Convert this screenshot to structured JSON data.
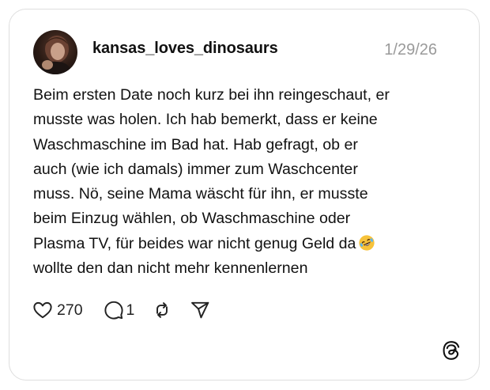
{
  "post": {
    "username": "kansas_loves_dinosaurs",
    "date": "1/29/26",
    "text_lines": [
      "Beim ersten Date noch kurz bei ihn reingeschaut, er",
      "musste was holen. Ich hab bemerkt, dass er keine",
      "Waschmaschine im Bad hat. Hab gefragt, ob er",
      "auch (wie ich damals) immer zum Waschcenter",
      "muss. Nö, seine Mama wäscht für ihn, er musste",
      "beim Einzug wählen, ob Waschmaschine oder",
      "Plasma TV, für beides war nicht genug Geld da",
      "wollte den dan nicht mehr kennenlernen"
    ],
    "emoji": "rolling-on-the-floor-laughing",
    "likes": "270",
    "replies": "1"
  },
  "icons": {
    "like": "heart-icon",
    "reply": "speech-bubble-icon",
    "repost": "repost-icon",
    "share": "send-icon",
    "brand": "threads-logo"
  },
  "colors": {
    "text": "#111111",
    "muted": "#9a9a9a",
    "border": "#dedede",
    "emoji_face": "#f7c23a"
  }
}
